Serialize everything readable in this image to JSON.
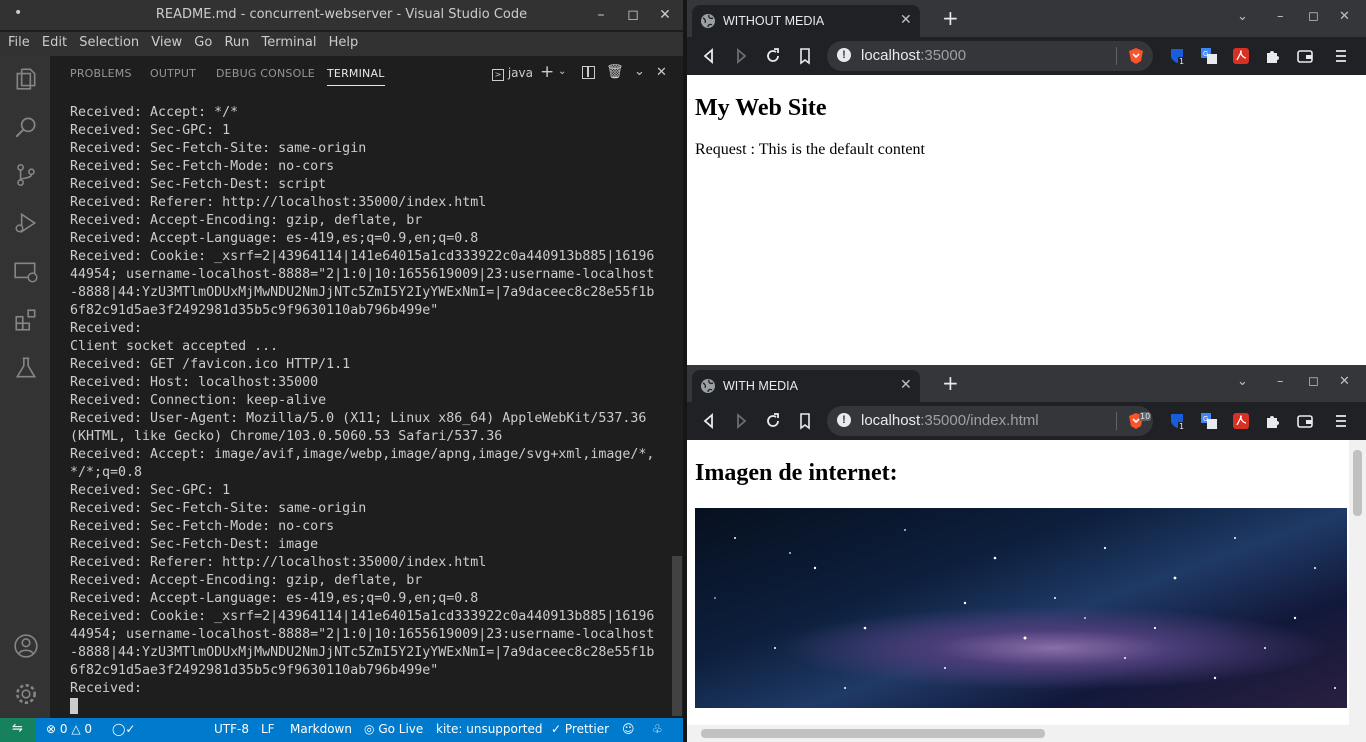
{
  "vscode": {
    "title": "README.md - concurrent-webserver - Visual Studio Code",
    "menu": [
      "File",
      "Edit",
      "Selection",
      "View",
      "Go",
      "Run",
      "Terminal",
      "Help"
    ],
    "panel_tabs": {
      "problems": "PROBLEMS",
      "output": "OUTPUT",
      "debug": "DEBUG CONSOLE",
      "terminal": "TERMINAL"
    },
    "terminal_shell": "java",
    "terminal_lines": [
      "Received: Accept: */*",
      "Received: Sec-GPC: 1",
      "Received: Sec-Fetch-Site: same-origin",
      "Received: Sec-Fetch-Mode: no-cors",
      "Received: Sec-Fetch-Dest: script",
      "Received: Referer: http://localhost:35000/index.html",
      "Received: Accept-Encoding: gzip, deflate, br",
      "Received: Accept-Language: es-419,es;q=0.9,en;q=0.8",
      "Received: Cookie: _xsrf=2|43964114|141e64015a1cd333922c0a440913b885|16196",
      "44954; username-localhost-8888=\"2|1:0|10:1655619009|23:username-localhost",
      "-8888|44:YzU3MTlmODUxMjMwNDU2NmJjNTc5ZmI5Y2IyYWExNmI=|7a9daceec8c28e55f1b",
      "6f82c91d5ae3f2492981d35b5c9f9630110ab796b499e\"",
      "Received:",
      "Client socket accepted ...",
      "Received: GET /favicon.ico HTTP/1.1",
      "Received: Host: localhost:35000",
      "Received: Connection: keep-alive",
      "Received: User-Agent: Mozilla/5.0 (X11; Linux x86_64) AppleWebKit/537.36",
      "(KHTML, like Gecko) Chrome/103.0.5060.53 Safari/537.36",
      "Received: Accept: image/avif,image/webp,image/apng,image/svg+xml,image/*,",
      "*/*;q=0.8",
      "Received: Sec-GPC: 1",
      "Received: Sec-Fetch-Site: same-origin",
      "Received: Sec-Fetch-Mode: no-cors",
      "Received: Sec-Fetch-Dest: image",
      "Received: Referer: http://localhost:35000/index.html",
      "Received: Accept-Encoding: gzip, deflate, br",
      "Received: Accept-Language: es-419,es;q=0.9,en;q=0.8",
      "Received: Cookie: _xsrf=2|43964114|141e64015a1cd333922c0a440913b885|16196",
      "44954; username-localhost-8888=\"2|1:0|10:1655619009|23:username-localhost",
      "-8888|44:YzU3MTlmODUxMjMwNDU2NmJjNTc5ZmI5Y2IyYWExNmI=|7a9daceec8c28e55f1b",
      "6f82c91d5ae3f2492981d35b5c9f9630110ab796b499e\"",
      "Received:"
    ],
    "status": {
      "errors": "0",
      "warnings": "0",
      "encoding": "UTF-8",
      "eol": "LF",
      "language": "Markdown",
      "golive": "Go Live",
      "kite": "kite: unsupported",
      "prettier": "Prettier"
    },
    "colors": {
      "statusbar": "#007acc",
      "remote": "#16825d",
      "activitybar": "#333333"
    }
  },
  "browser_top": {
    "tab_title": "WITHOUT MEDIA",
    "url_host": "localhost",
    "url_rest": ":35000",
    "page": {
      "heading": "My Web Site",
      "paragraph": "Request : This is the default content"
    }
  },
  "browser_bottom": {
    "tab_title": "WITH MEDIA",
    "url_host": "localhost",
    "url_rest": ":35000/index.html",
    "shield_badge": "10",
    "page": {
      "heading": "Imagen de internet:"
    }
  },
  "extension_badge": "1",
  "icons": [
    "vscode-logo-icon",
    "files-icon",
    "search-icon",
    "source-control-icon",
    "run-debug-icon",
    "remote-explorer-icon",
    "extensions-icon",
    "testing-icon",
    "account-icon",
    "settings-gear-icon",
    "globe-icon",
    "back-icon",
    "forward-icon",
    "reload-icon",
    "bookmark-icon",
    "brave-shield-icon",
    "bitwarden-icon",
    "translate-icon",
    "pdf-icon",
    "extensions-puzzle-icon",
    "wallet-icon",
    "menu-icon"
  ]
}
